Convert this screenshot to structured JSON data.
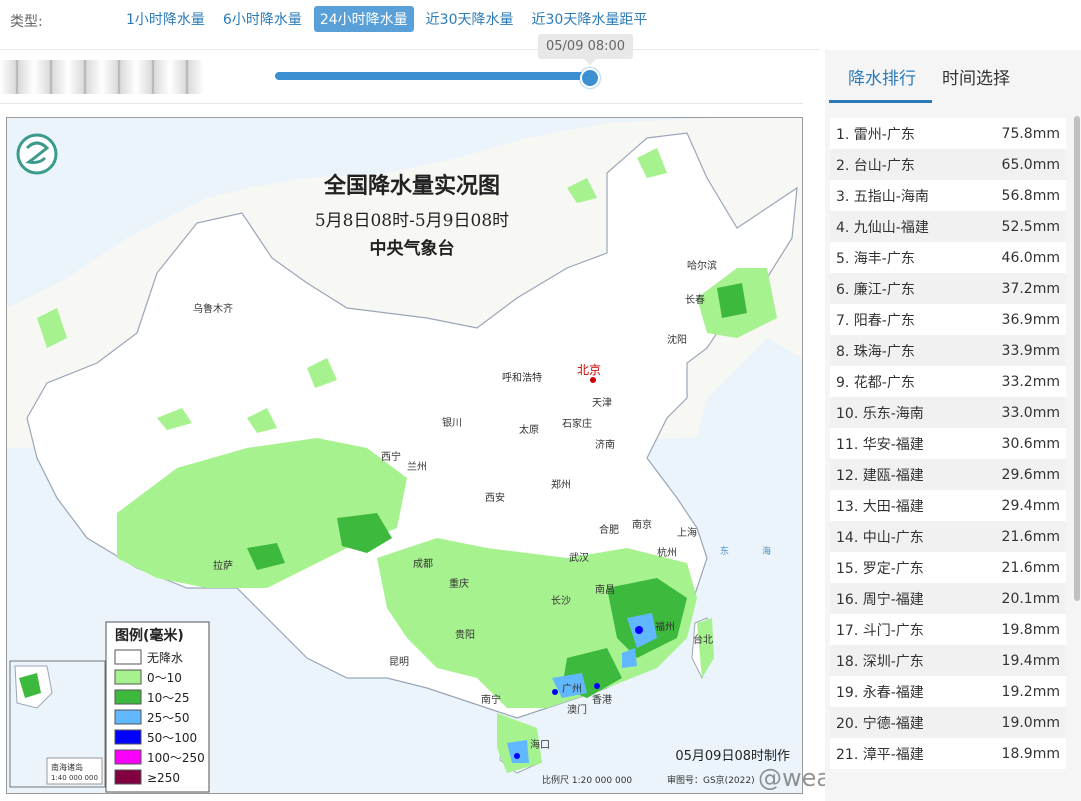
{
  "header": {
    "type_label": "类型:",
    "tabs": [
      {
        "label": "1小时降水量"
      },
      {
        "label": "6小时降水量"
      },
      {
        "label": "24小时降水量"
      },
      {
        "label": "近30天降水量"
      },
      {
        "label": "近30天降水量距平"
      }
    ],
    "active_tab": 2
  },
  "timeline": {
    "tooltip": "05/09 08:00",
    "position_fraction": 1.0
  },
  "map": {
    "title": "全国降水量实况图",
    "subtitle": "5月8日08时-5月9日08时",
    "agency": "中央气象台",
    "made_time": "05月09日08时制作",
    "scale": "比例尺 1:20 000 000",
    "review_no": "审图号：GS京(2022)",
    "capital": "北京",
    "cities": [
      {
        "name": "乌鲁木齐"
      },
      {
        "name": "哈尔滨"
      },
      {
        "name": "长春"
      },
      {
        "name": "沈阳"
      },
      {
        "name": "呼和浩特"
      },
      {
        "name": "天津"
      },
      {
        "name": "银川"
      },
      {
        "name": "太原"
      },
      {
        "name": "石家庄"
      },
      {
        "name": "济南"
      },
      {
        "name": "西宁"
      },
      {
        "name": "兰州"
      },
      {
        "name": "郑州"
      },
      {
        "name": "西安"
      },
      {
        "name": "合肥"
      },
      {
        "name": "南京"
      },
      {
        "name": "上海"
      },
      {
        "name": "杭州"
      },
      {
        "name": "武汉"
      },
      {
        "name": "成都"
      },
      {
        "name": "拉萨"
      },
      {
        "name": "重庆"
      },
      {
        "name": "长沙"
      },
      {
        "name": "南昌"
      },
      {
        "name": "福州"
      },
      {
        "name": "台北"
      },
      {
        "name": "贵阳"
      },
      {
        "name": "昆明"
      },
      {
        "name": "南宁"
      },
      {
        "name": "广州"
      },
      {
        "name": "香港"
      },
      {
        "name": "澳门"
      },
      {
        "name": "海口"
      }
    ],
    "sea_labels": [
      "东",
      "海"
    ],
    "inset_label": "南海诸岛",
    "inset_scale": "1:40 000 000",
    "legend": {
      "title": "图例(毫米)",
      "items": [
        {
          "label": "无降水",
          "color": "#ffffff"
        },
        {
          "label": "0～10",
          "color": "#a6f28f"
        },
        {
          "label": "10～25",
          "color": "#3dba3d"
        },
        {
          "label": "25～50",
          "color": "#61b8ff"
        },
        {
          "label": "50～100",
          "color": "#0000ff"
        },
        {
          "label": "100～250",
          "color": "#fa00fa"
        },
        {
          "label": "≥250",
          "color": "#800040"
        }
      ]
    }
  },
  "watermark": "@weatherman_信欣",
  "panel": {
    "tabs": [
      {
        "label": "降水排行"
      },
      {
        "label": "时间选择"
      }
    ],
    "active_tab": 0,
    "ranking": [
      {
        "station": "1. 雷州-广东",
        "value": "75.8mm"
      },
      {
        "station": "2. 台山-广东",
        "value": "65.0mm"
      },
      {
        "station": "3. 五指山-海南",
        "value": "56.8mm"
      },
      {
        "station": "4. 九仙山-福建",
        "value": "52.5mm"
      },
      {
        "station": "5. 海丰-广东",
        "value": "46.0mm"
      },
      {
        "station": "6. 廉江-广东",
        "value": "37.2mm"
      },
      {
        "station": "7. 阳春-广东",
        "value": "36.9mm"
      },
      {
        "station": "8. 珠海-广东",
        "value": "33.9mm"
      },
      {
        "station": "9. 花都-广东",
        "value": "33.2mm"
      },
      {
        "station": "10. 乐东-海南",
        "value": "33.0mm"
      },
      {
        "station": "11. 华安-福建",
        "value": "30.6mm"
      },
      {
        "station": "12. 建瓯-福建",
        "value": "29.6mm"
      },
      {
        "station": "13. 大田-福建",
        "value": "29.4mm"
      },
      {
        "station": "14. 中山-广东",
        "value": "21.6mm"
      },
      {
        "station": "15. 罗定-广东",
        "value": "21.6mm"
      },
      {
        "station": "16. 周宁-福建",
        "value": "20.1mm"
      },
      {
        "station": "17. 斗门-广东",
        "value": "19.8mm"
      },
      {
        "station": "18. 深圳-广东",
        "value": "19.4mm"
      },
      {
        "station": "19. 永春-福建",
        "value": "19.2mm"
      },
      {
        "station": "20. 宁德-福建",
        "value": "19.0mm"
      },
      {
        "station": "21. 漳平-福建",
        "value": "18.9mm"
      }
    ]
  }
}
